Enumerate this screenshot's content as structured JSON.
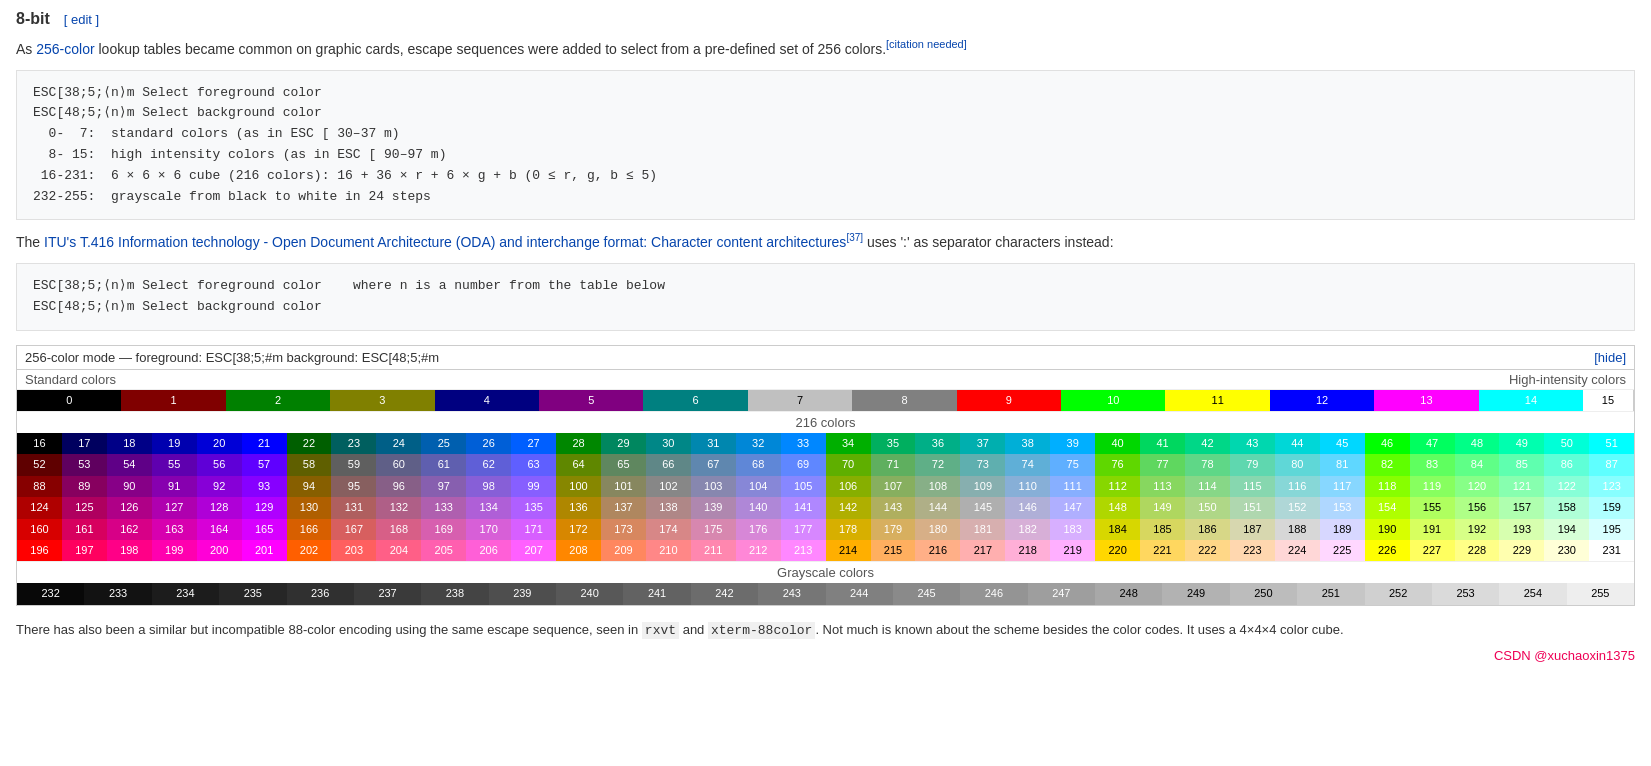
{
  "heading": {
    "title": "8-bit",
    "edit_label": "[ edit ]"
  },
  "intro": {
    "text_before": "As ",
    "link_text": "256-color",
    "text_after": " lookup tables became common on graphic cards, escape sequences were added to select from a pre-defined set of 256 colors.",
    "citation": "[citation needed]"
  },
  "code_block_1": {
    "lines": [
      "ESC[38;5;⟨n⟩m Select foreground color",
      "ESC[48;5;⟨n⟩m Select background color",
      "  0-  7:  standard colors (as in ESC [ 30–37 m)",
      "  8- 15:  high intensity colors (as in ESC [ 90–97 m)",
      " 16-231:  6 × 6 × 6 cube (216 colors): 16 + 36 × r + 6 × g + b (0 ≤ r, g, b ≤ 5)",
      "232-255:  grayscale from black to white in 24 steps"
    ]
  },
  "oda_text": {
    "text_before": "The ",
    "link_text": "ITU's T.416 Information technology - Open Document Architecture (ODA) and interchange format: Character content architectures",
    "ref": "[37]",
    "text_after": " uses ':' as separator characters instead:"
  },
  "code_block_2": {
    "line1": "ESC[38;5;⟨n⟩m Select foreground color",
    "line1_comment": "    where n is a number from the table below",
    "line2": "ESC[48;5;⟨n⟩m Select background color"
  },
  "color_table": {
    "title": "256-color mode — foreground: ESC[38;5;#m  background: ESC[48;5;#m",
    "hide_label": "[hide]",
    "standard_label": "Standard colors",
    "hicol_label": "High-intensity colors",
    "col216_label": "216 colors",
    "grayscale_label": "Grayscale colors"
  },
  "bottom_text": {
    "text": "There has also been a similar but incompatible 88-color encoding using the same escape sequence, seen in ",
    "code1": "rxvt",
    "text2": " and ",
    "code2": "xterm-88color",
    "text3": ". Not much is known about the scheme besides the color codes. It uses a 4×4×4 color cube."
  },
  "watermark": "CSDN @xuchaoxin1375"
}
